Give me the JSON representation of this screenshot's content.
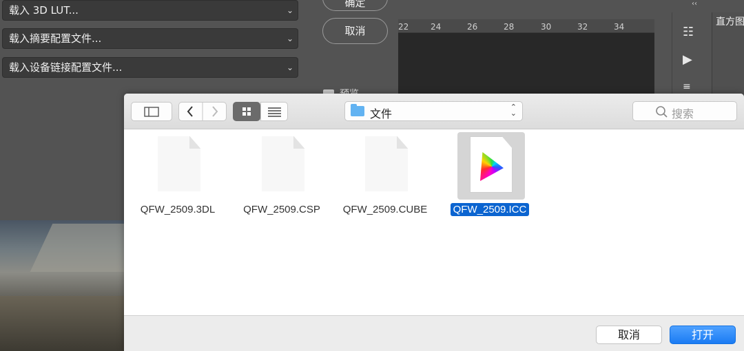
{
  "photoshop": {
    "load_selects": [
      "载入 3D LUT...",
      "载入摘要配置文件...",
      "载入设备链接配置文件..."
    ],
    "ok_button": "确定",
    "cancel_button": "取消",
    "preview_label": "预览",
    "ruler_ticks": [
      "22",
      "24",
      "26",
      "28",
      "30",
      "32",
      "34"
    ],
    "panel_title": "直方图"
  },
  "dialog": {
    "location": "文件",
    "search_placeholder": "搜索",
    "files": [
      {
        "name": "QFW_2509.3DL",
        "selected": false
      },
      {
        "name": "QFW_2509.CSP",
        "selected": false
      },
      {
        "name": "QFW_2509.CUBE",
        "selected": false
      },
      {
        "name": "QFW_2509.ICC",
        "selected": true
      }
    ],
    "cancel_button": "取消",
    "open_button": "打开"
  },
  "colors": {
    "accent": "#1a7bf3",
    "selection": "#0b64d0",
    "folder": "#62b3f2"
  }
}
